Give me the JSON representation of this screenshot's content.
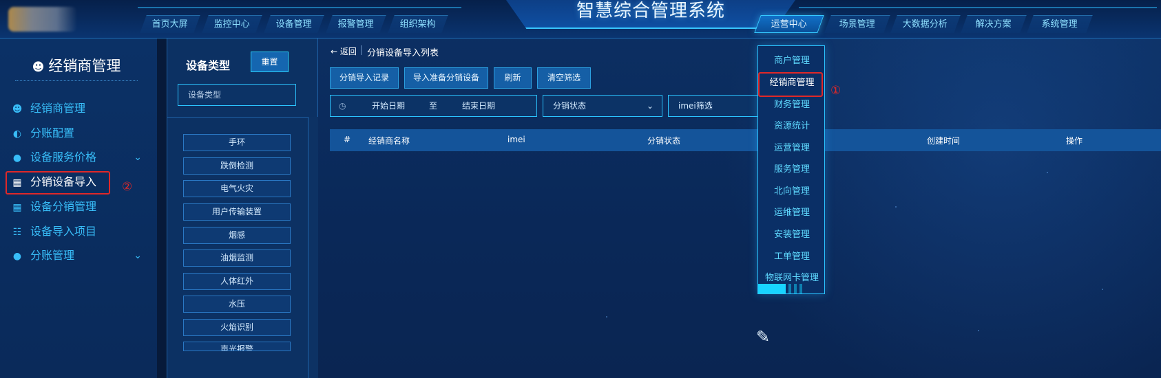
{
  "header": {
    "system_title": "智慧综合管理系统",
    "nav_left": [
      "首页大屏",
      "监控中心",
      "设备管理",
      "报警管理",
      "组织架构"
    ],
    "nav_right": [
      "运营中心",
      "场景管理",
      "大数据分析",
      "解决方案",
      "系统管理"
    ],
    "active_nav": "运营中心"
  },
  "sidebar": {
    "title": "经销商管理",
    "items": [
      {
        "label": "经销商管理",
        "icon": "users-icon",
        "has_children": false
      },
      {
        "label": "分账配置",
        "icon": "pie-chart-icon",
        "has_children": false
      },
      {
        "label": "设备服务价格",
        "icon": "money-bag-icon",
        "has_children": true
      },
      {
        "label": "分销设备导入",
        "icon": "grid-icon",
        "has_children": false,
        "active": true
      },
      {
        "label": "设备分销管理",
        "icon": "grid-icon",
        "has_children": false
      },
      {
        "label": "设备导入项目",
        "icon": "book-icon",
        "has_children": false
      },
      {
        "label": "分账管理",
        "icon": "money-bag-icon",
        "has_children": true
      }
    ],
    "annotation_mark": "②"
  },
  "type_panel": {
    "title": "设备类型",
    "reset_label": "重置",
    "search_placeholder": "设备类型",
    "items": [
      "手环",
      "跌倒检测",
      "电气火灾",
      "用户传输装置",
      "烟感",
      "油烟监测",
      "人体红外",
      "水压",
      "火焰识别",
      "声光报警"
    ]
  },
  "main": {
    "back_label": "返回",
    "page_title": "分销设备导入列表",
    "toolbar": [
      "分销导入记录",
      "导入准备分销设备",
      "刷新",
      "清空筛选"
    ],
    "filters": {
      "start_date_placeholder": "开始日期",
      "date_sep": "至",
      "end_date_placeholder": "结束日期",
      "status_placeholder": "分销状态",
      "imei_placeholder": "imei筛选"
    },
    "table_columns": [
      "#",
      "经销商名称",
      "imei",
      "分销状态",
      "创建时间",
      "操作"
    ]
  },
  "dropdown": {
    "items": [
      "商户管理",
      "经销商管理",
      "财务管理",
      "资源统计",
      "运营管理",
      "服务管理",
      "北向管理",
      "运维管理",
      "安装管理",
      "工单管理",
      "物联网卡管理"
    ],
    "selected": "经销商管理",
    "annotation_mark": "①"
  },
  "colors": {
    "accent": "#2bc4ff",
    "link": "#38bdf8",
    "highlight_box": "#e02828",
    "background": "#0b2a5a"
  }
}
